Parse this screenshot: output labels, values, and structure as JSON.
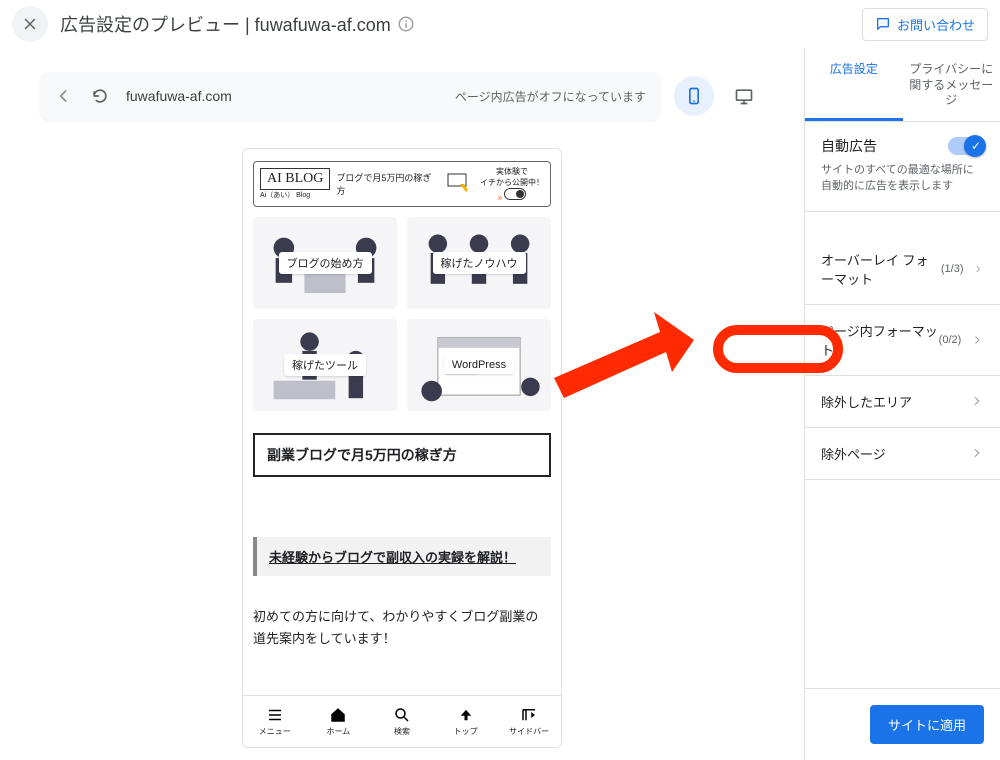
{
  "header": {
    "title": "広告設定のプレビュー | fuwafuwa-af.com",
    "contact_label": "お問い合わせ"
  },
  "urlbar": {
    "url": "fuwafuwa-af.com",
    "inpage_off": "ページ内広告がオフになっています"
  },
  "devices": {
    "mobile": "mobile",
    "desktop": "desktop"
  },
  "preview": {
    "logo": "AI BLOG",
    "logo_sub": "Ai（あい） Blog",
    "top_caption": "ブログで月5万円の稼ぎ方",
    "experience_line1": "実体験で",
    "experience_line2": "イチから公開中！",
    "cards": [
      {
        "label": "ブログの始め方"
      },
      {
        "label": "稼げたノウハウ"
      },
      {
        "label": "稼げたツール"
      },
      {
        "label": "WordPress"
      }
    ],
    "headline": "副業ブログで月5万円の稼ぎ方",
    "sub_headline": "未経験からブログで副収入の実録を解説！",
    "intro": "初めての方に向けて、わかりやすくブログ副業の道先案内をしています！",
    "nav": [
      {
        "label": "メニュー"
      },
      {
        "label": "ホーム"
      },
      {
        "label": "検索"
      },
      {
        "label": "トップ"
      },
      {
        "label": "サイドバー"
      }
    ]
  },
  "sidepanel": {
    "tabs": {
      "ads": "広告設定",
      "privacy": "プライバシーに関するメッセージ"
    },
    "auto_ads": {
      "title": "自動広告",
      "desc": "サイトのすべての最適な場所に自動的に広告を表示します"
    },
    "rows": {
      "overlay": {
        "label": "オーバーレイ フォーマット",
        "count": "(1/3)"
      },
      "inpage": {
        "label": "ページ内フォーマット",
        "count": "(0/2)"
      },
      "excluded_area": {
        "label": "除外したエリア"
      },
      "excluded_page": {
        "label": "除外ページ"
      }
    },
    "apply": "サイトに適用"
  }
}
